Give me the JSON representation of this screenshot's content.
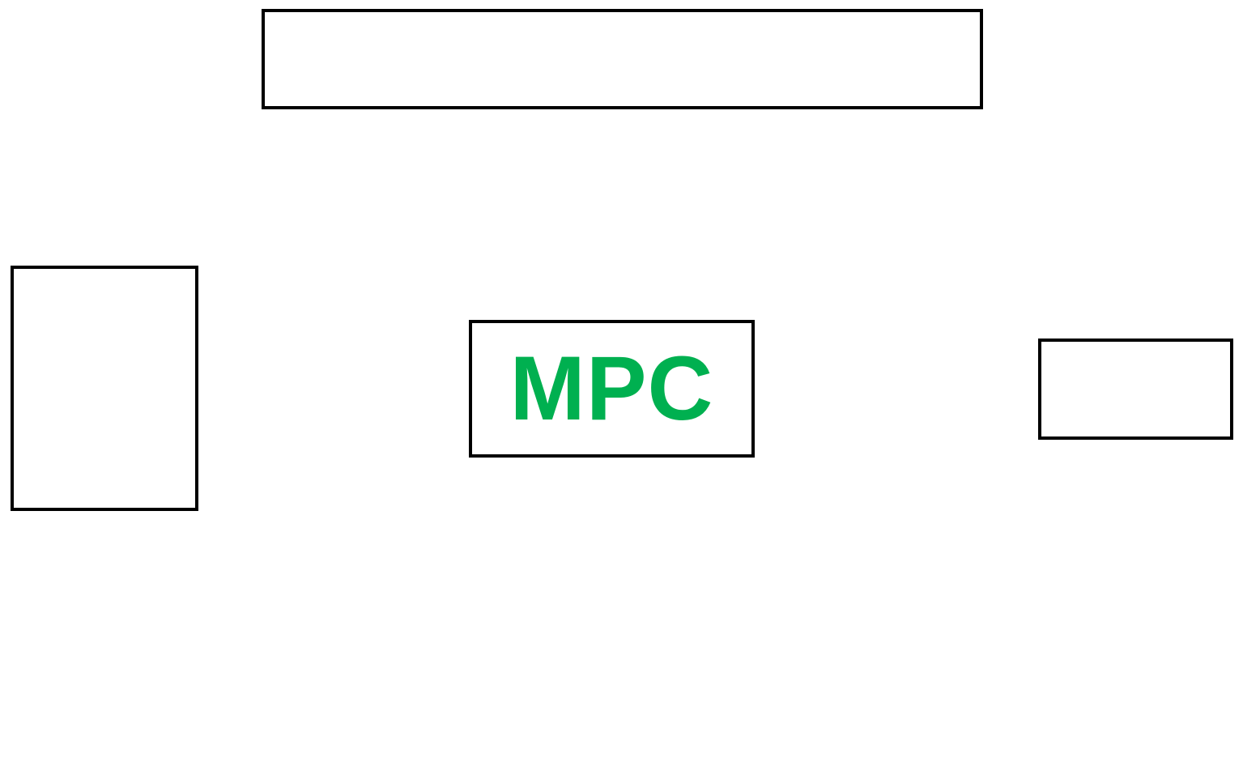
{
  "diagram": {
    "center_block": {
      "label": "MPC",
      "label_color": "#00b050"
    },
    "border_color": "#000000",
    "background_color": "#ffffff"
  }
}
